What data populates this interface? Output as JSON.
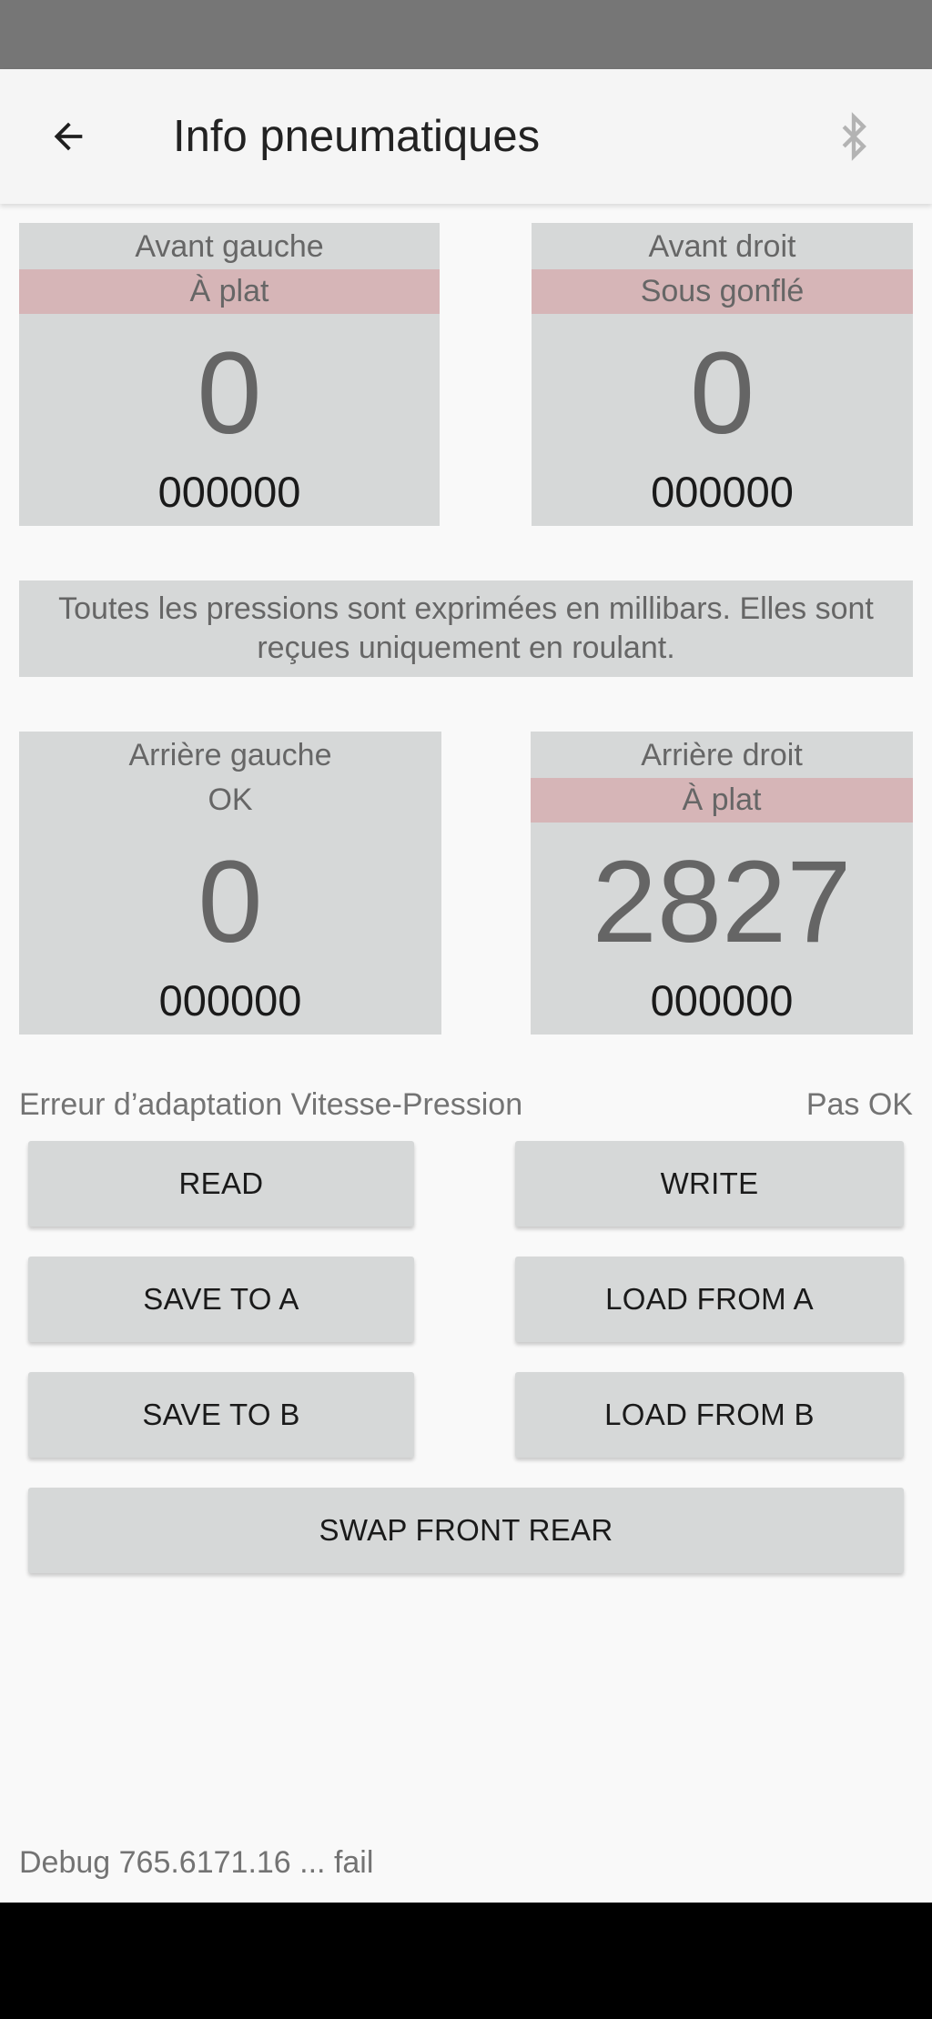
{
  "app_bar": {
    "title": "Info pneumatiques",
    "back_icon": "arrow-back-icon",
    "bluetooth_icon": "bluetooth-icon"
  },
  "tires": {
    "front_left": {
      "name": "Avant gauche",
      "status": "À plat",
      "status_alert": true,
      "pressure": "0",
      "sensor_id": "000000"
    },
    "front_right": {
      "name": "Avant droit",
      "status": "Sous gonflé",
      "status_alert": true,
      "pressure": "0",
      "sensor_id": "000000"
    },
    "rear_left": {
      "name": "Arrière gauche",
      "status": "OK",
      "status_alert": false,
      "pressure": "0",
      "sensor_id": "000000"
    },
    "rear_right": {
      "name": "Arrière droit",
      "status": "À plat",
      "status_alert": true,
      "pressure": "2827",
      "sensor_id": "000000"
    }
  },
  "info_text": "Toutes les pressions sont exprimées en millibars. Elles sont reçues uniquement en roulant.",
  "speed_pressure": {
    "label": "Erreur d’adaptation Vitesse-Pression",
    "value": "Pas OK"
  },
  "buttons": {
    "read": "READ",
    "write": "WRITE",
    "save_a": "SAVE TO A",
    "load_a": "LOAD FROM A",
    "save_b": "SAVE TO B",
    "load_b": "LOAD FROM B",
    "swap": "SWAP FRONT REAR"
  },
  "debug_text": "Debug 765.6171.16 ... fail",
  "colors": {
    "card_bg": "#d6d8d8",
    "alert_bg": "#d6b5b7",
    "page_bg": "#f9f9f9",
    "status_bar": "#767676",
    "bluetooth_icon": "#b3b3b3"
  }
}
